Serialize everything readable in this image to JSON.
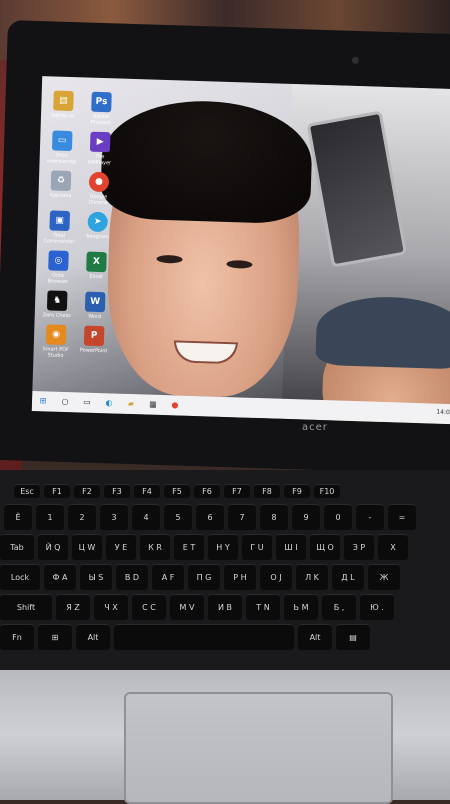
{
  "desktop": {
    "icons": [
      {
        "label": "laptop.uz",
        "icon": "laptop-folder-icon",
        "color": "#d8a437"
      },
      {
        "label": "Adobe Photosh",
        "icon": "photoshop-icon",
        "color": "#2f6fc9"
      },
      {
        "label": "Этот компьютер",
        "icon": "computer-icon",
        "color": "#3a8be0"
      },
      {
        "label": "The KMPlayer",
        "icon": "kmplayer-icon",
        "color": "#6a3ec2"
      },
      {
        "label": "Корзина",
        "icon": "recycle-bin-icon",
        "color": "#9aa6b5"
      },
      {
        "label": "Google Chrome",
        "icon": "chrome-icon",
        "color": "#e0442f"
      },
      {
        "label": "Total Commander",
        "icon": "floppy-icon",
        "color": "#2d64c4"
      },
      {
        "label": "Telegram",
        "icon": "telegram-icon",
        "color": "#2fa3e0"
      },
      {
        "label": "Octa Browser",
        "icon": "octa-browser-icon",
        "color": "#2a62d1"
      },
      {
        "label": "Excel",
        "icon": "excel-icon",
        "color": "#1f7a44"
      },
      {
        "label": "Zero Chess",
        "icon": "chess-knight-icon",
        "color": "#111111"
      },
      {
        "label": "Word",
        "icon": "word-icon",
        "color": "#2b5faf"
      },
      {
        "label": "Smart PDF Studio",
        "icon": "pdf-studio-icon",
        "color": "#e58a1f"
      },
      {
        "label": "PowerPoint",
        "icon": "powerpoint-icon",
        "color": "#c4462b"
      }
    ]
  },
  "taskbar": {
    "items": [
      {
        "icon": "windows-start-icon"
      },
      {
        "icon": "search-icon"
      },
      {
        "icon": "task-view-icon"
      },
      {
        "icon": "edge-icon"
      },
      {
        "icon": "file-explorer-icon"
      },
      {
        "icon": "store-icon"
      },
      {
        "icon": "chrome-icon"
      }
    ],
    "clock": "14:0"
  },
  "laptop": {
    "brand": "acer"
  },
  "keyboard": {
    "rows": [
      [
        "Esc",
        "F1",
        "F2",
        "F3",
        "F4",
        "F5",
        "F6",
        "F7",
        "F8",
        "F9",
        "F10"
      ],
      [
        "Ё",
        "1",
        "2",
        "3",
        "4",
        "5",
        "6",
        "7",
        "8",
        "9",
        "0",
        "-",
        "="
      ],
      [
        "Tab",
        "Й Q",
        "Ц W",
        "У E",
        "К R",
        "Е T",
        "Н Y",
        "Г U",
        "Ш I",
        "Щ O",
        "З P",
        "Х"
      ],
      [
        "Lock",
        "Ф A",
        "Ы S",
        "В D",
        "А F",
        "П G",
        "Р H",
        "О J",
        "Л K",
        "Д L",
        "Ж"
      ],
      [
        "Shift",
        "Я Z",
        "Ч X",
        "С C",
        "М V",
        "И B",
        "Т N",
        "Ь M",
        "Б ,",
        "Ю ."
      ],
      [
        "Fn",
        "⊞",
        "Alt",
        "",
        "Alt",
        "▤"
      ]
    ]
  }
}
